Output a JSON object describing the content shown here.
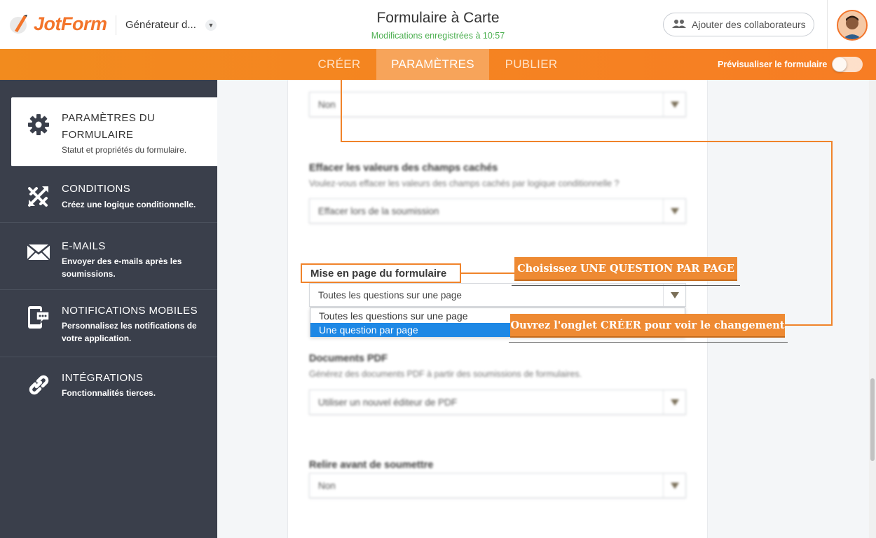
{
  "app": {
    "brand": "JotForm",
    "generator": "Générateur d...",
    "form_title": "Formulaire à Carte",
    "saved_status": "Modifications enregistrées à 10:57",
    "collab_label": "Ajouter des collaborateurs"
  },
  "nav": {
    "tabs": [
      {
        "label": "CRÉER"
      },
      {
        "label": "PARAMÈTRES"
      },
      {
        "label": "PUBLIER"
      }
    ],
    "active_tab": "PARAMÈTRES",
    "preview_label": "Prévisualiser le formulaire"
  },
  "sidebar": {
    "items": [
      {
        "title_line1": "PARAMÈTRES DU",
        "title_line2": "FORMULAIRE",
        "desc": "Statut et propriétés du formulaire.",
        "icon": "gear-icon"
      },
      {
        "title": "CONDITIONS",
        "desc": "Créez une logique conditionnelle.",
        "icon": "conditions-icon"
      },
      {
        "title": "E-MAILS",
        "desc_line1": "Envoyer des e-mails après les",
        "desc_line2": "soumissions.",
        "icon": "envelope-icon"
      },
      {
        "title": "NOTIFICATIONS MOBILES",
        "desc_line1": "Personnalisez les notifications de",
        "desc_line2": "votre application.",
        "icon": "mobile-notification-icon"
      },
      {
        "title": "INTÉGRATIONS",
        "desc": "Fonctionnalités tierces.",
        "icon": "link-icon"
      }
    ]
  },
  "settings": {
    "top_select": "Non",
    "clear_hidden": {
      "label": "Effacer les valeurs des champs cachés",
      "sub": "Voulez-vous effacer les valeurs des champs cachés par logique conditionnelle ?",
      "value": "Effacer lors de la soumission"
    },
    "layout": {
      "label": "Mise en page du formulaire",
      "value": "Toutes les questions sur une page",
      "options": [
        "Toutes les questions sur une page",
        "Une question par page"
      ],
      "highlighted": "Une question par page"
    },
    "pdf": {
      "label": "Documents PDF",
      "sub": "Générez des documents PDF à partir des soumissions de formulaires.",
      "value": "Utiliser un nouvel éditeur de PDF"
    },
    "review": {
      "label": "Relire avant de soumettre",
      "value": "Non"
    }
  },
  "callouts": {
    "first": "Choisissez UNE QUESTION PAR PAGE",
    "second": "Ouvrez l'onglet CRÉER pour voir le changement"
  },
  "colors": {
    "accent": "#f3742a",
    "nav": "#f77d24",
    "sidebar": "#3a3f4b",
    "highlight": "#1e88e5",
    "saved": "#4caf50"
  }
}
